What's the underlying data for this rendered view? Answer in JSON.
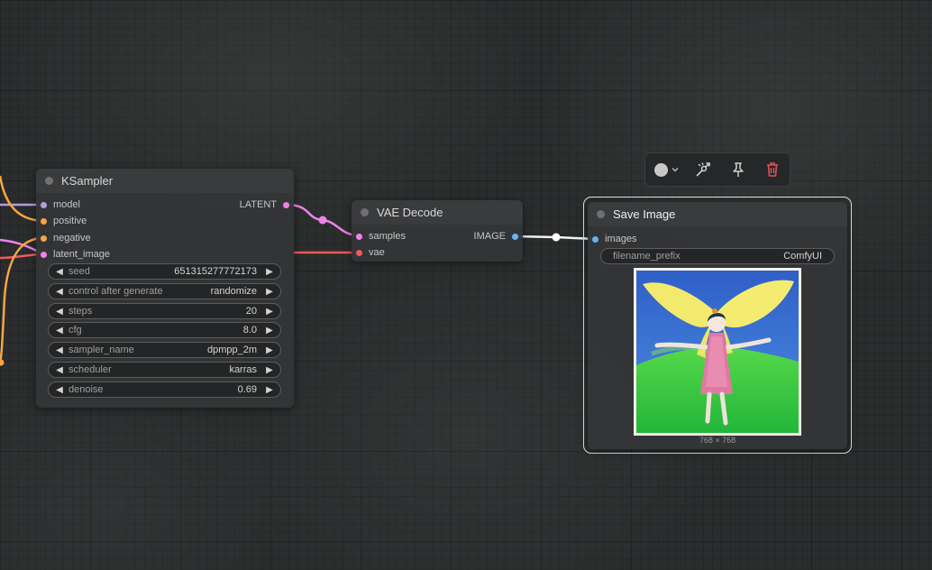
{
  "colors": {
    "model": "#b39ddb",
    "conditioning": "#f5a742",
    "latent": "#ee82e8",
    "vae": "#ee5b5b",
    "image": "#64b5f6",
    "delete": "#e05252"
  },
  "toolbar": {
    "color_icon": "color-circle-icon",
    "bypass_icon": "bypass-icon",
    "pin_icon": "pin-icon",
    "delete_icon": "trash-icon"
  },
  "ksampler": {
    "title": "KSampler",
    "inputs": [
      "model",
      "positive",
      "negative",
      "latent_image"
    ],
    "output": "LATENT",
    "widgets": [
      {
        "name": "seed",
        "value": "651315277772173"
      },
      {
        "name": "control after generate",
        "value": "randomize"
      },
      {
        "name": "steps",
        "value": "20"
      },
      {
        "name": "cfg",
        "value": "8.0"
      },
      {
        "name": "sampler_name",
        "value": "dpmpp_2m"
      },
      {
        "name": "scheduler",
        "value": "karras"
      },
      {
        "name": "denoise",
        "value": "0.69"
      }
    ]
  },
  "vae_decode": {
    "title": "VAE Decode",
    "inputs": [
      "samples",
      "vae"
    ],
    "output": "IMAGE"
  },
  "save_image": {
    "title": "Save Image",
    "input": "images",
    "filename_prefix_label": "filename_prefix",
    "filename_prefix_value": "ComfyUI",
    "image_size": "768 × 768"
  }
}
